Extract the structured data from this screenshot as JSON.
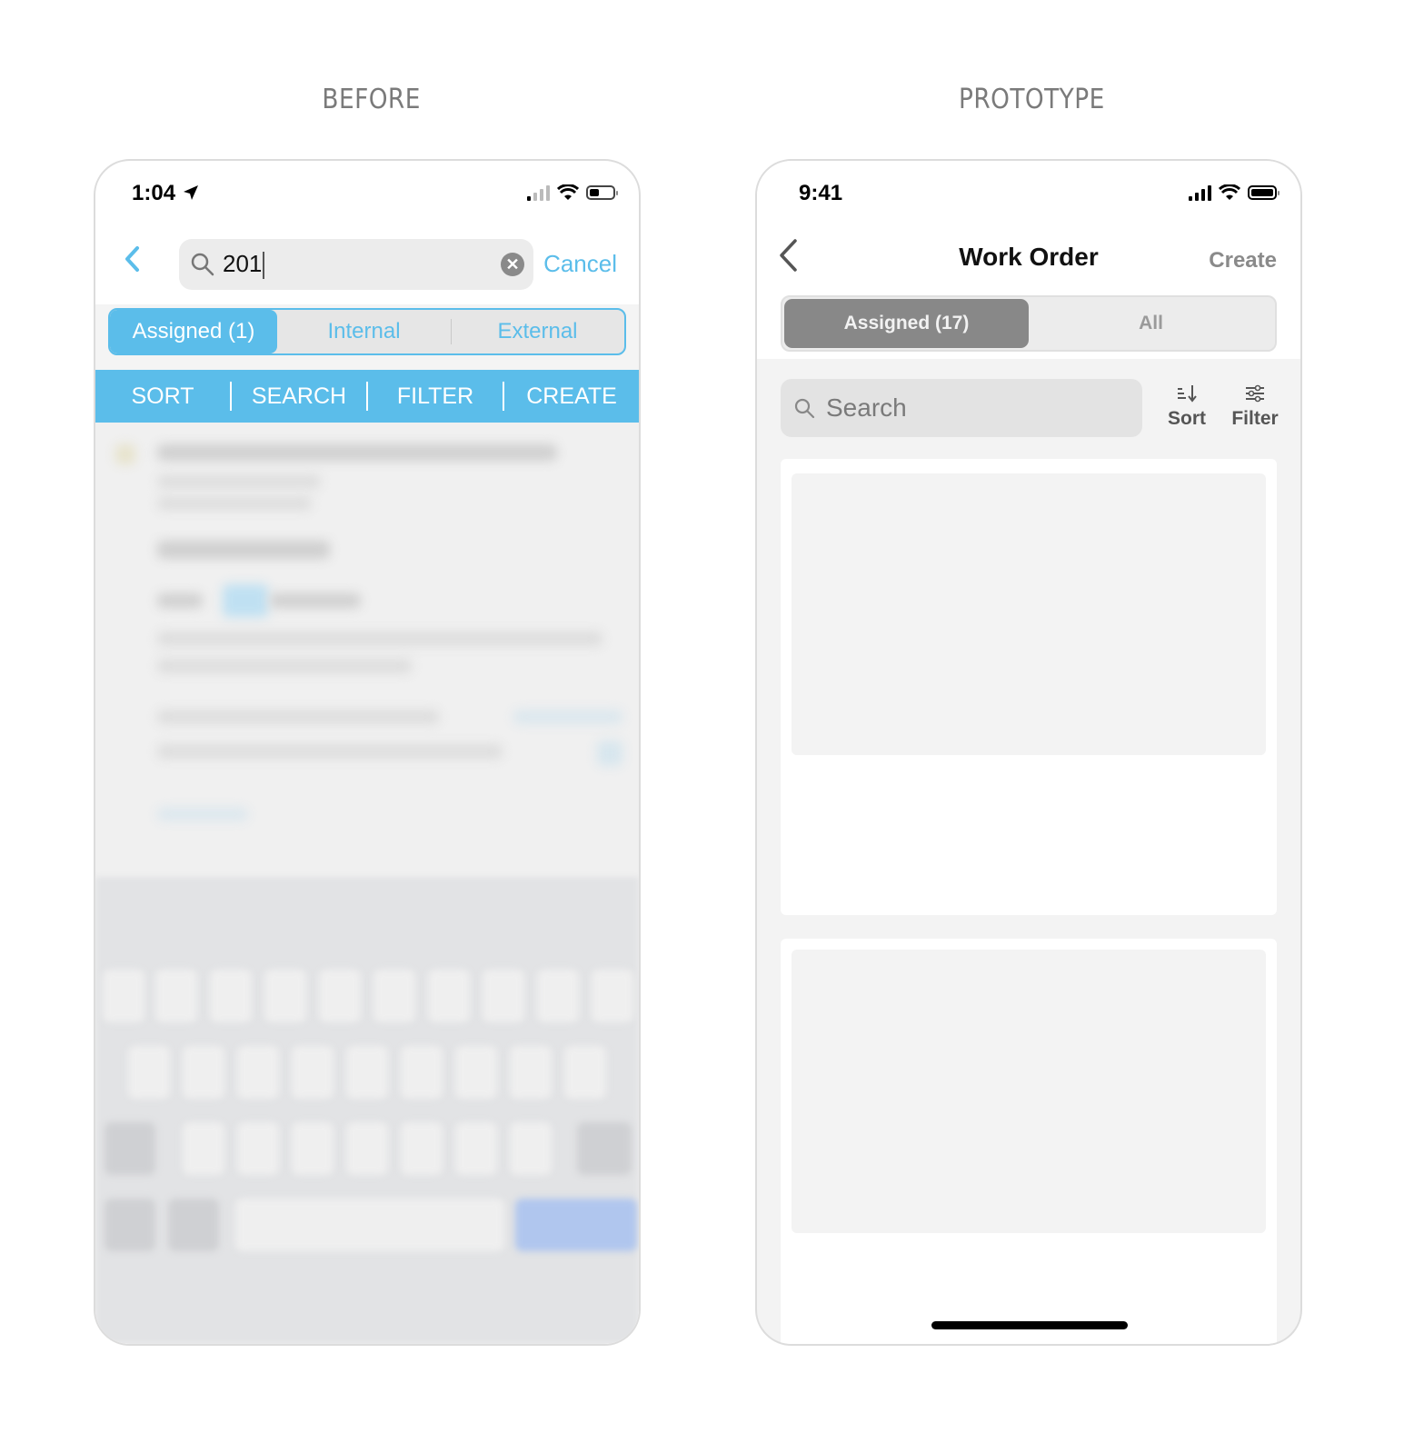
{
  "headings": {
    "before": "BEFORE",
    "prototype": "PROTOTYPE"
  },
  "before": {
    "status": {
      "time": "1:04",
      "location_icon": "location-arrow-icon",
      "signal_bars_active": 1,
      "battery_level": 0.35
    },
    "back_icon": "chevron-left-icon",
    "search": {
      "value": "201",
      "icon": "magnifier-icon",
      "clear_icon": "clear-circle-icon",
      "clear_glyph": "✕"
    },
    "cancel_label": "Cancel",
    "segments": [
      {
        "label": "Assigned (1)",
        "active": true
      },
      {
        "label": "Internal",
        "active": false
      },
      {
        "label": "External",
        "active": false
      }
    ],
    "actions": [
      "SORT",
      "SEARCH",
      "FILTER",
      "CREATE"
    ],
    "colors": {
      "accent": "#5bbdea"
    },
    "note": "Content below action bar and keyboard are blurred"
  },
  "prototype": {
    "status": {
      "time": "9:41",
      "signal_bars_active": 4,
      "battery_level": 1.0
    },
    "back_icon": "chevron-left-icon",
    "title": "Work Order",
    "create_label": "Create",
    "segments": [
      {
        "label": "Assigned (17)",
        "active": true
      },
      {
        "label": "All",
        "active": false
      }
    ],
    "search": {
      "placeholder": "Search",
      "icon": "magnifier-icon"
    },
    "sort_label": "Sort",
    "filter_label": "Filter",
    "cards": 2,
    "colors": {
      "segment_active": "#888888",
      "background": "#f3f3f3"
    }
  }
}
